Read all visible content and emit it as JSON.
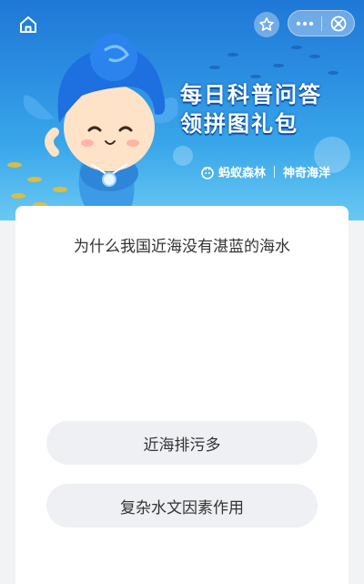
{
  "header": {
    "headline_line1": "每日科普问答",
    "headline_line2": "领拼图礼包",
    "brand_primary": "蚂蚁森林",
    "brand_secondary": "神奇海洋",
    "icons": [
      "home-icon",
      "star-icon",
      "more-icon",
      "close-icon"
    ]
  },
  "quiz": {
    "question": "为什么我国近海没有湛蓝的海水",
    "options": [
      "近海排污多",
      "复杂水文因素作用"
    ]
  },
  "colors": {
    "banner_top": "#1f78d6",
    "banner_bottom": "#6ac8f2",
    "page_bg": "#f2f3f5",
    "option_bg": "#eef0f3",
    "text": "#333333"
  }
}
